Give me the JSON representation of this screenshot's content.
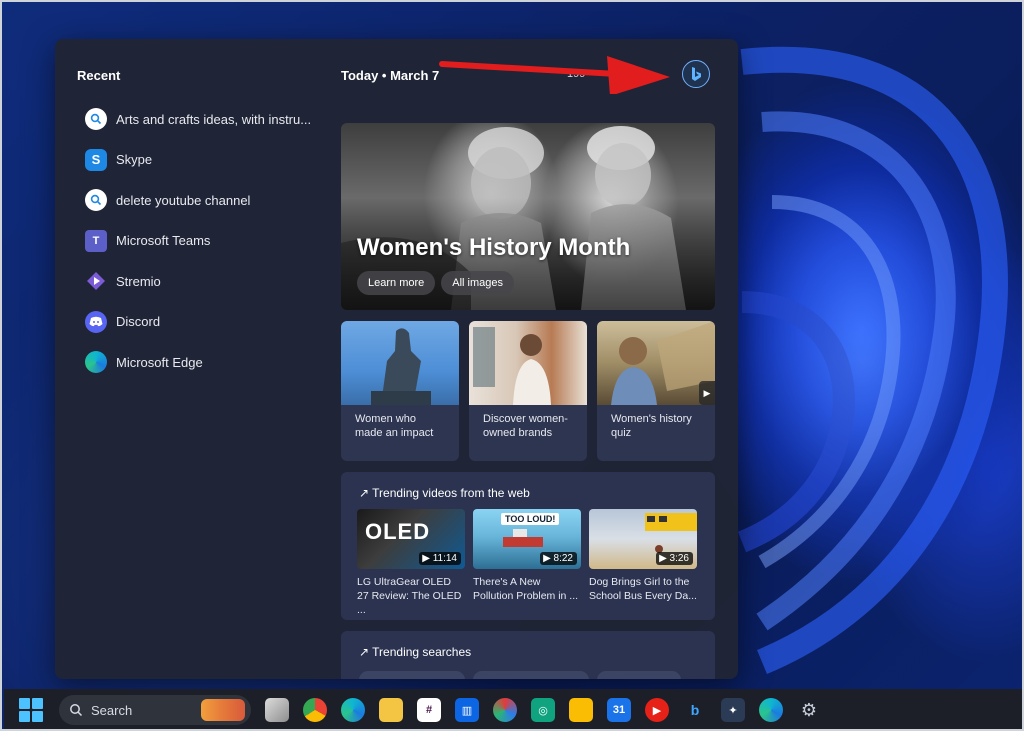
{
  "panel": {
    "recent_title": "Recent",
    "recent_items": [
      {
        "label": "Arts and crafts ideas, with instru...",
        "icon": "search-icon"
      },
      {
        "label": "Skype",
        "icon": "skype-icon"
      },
      {
        "label": "delete youtube channel",
        "icon": "search-icon"
      },
      {
        "label": "Microsoft Teams",
        "icon": "teams-icon"
      },
      {
        "label": "Stremio",
        "icon": "stremio-icon"
      },
      {
        "label": "Discord",
        "icon": "discord-icon"
      },
      {
        "label": "Microsoft Edge",
        "icon": "edge-icon"
      }
    ],
    "today_label": "Today  •  March 7",
    "points": "199",
    "hero": {
      "title": "Women's History Month",
      "learn_more": "Learn more",
      "all_images": "All images"
    },
    "cards": [
      {
        "caption": "Women who made an impact"
      },
      {
        "caption": "Discover women-owned brands"
      },
      {
        "caption": "Women's history quiz"
      }
    ],
    "trending_videos": {
      "title": "↗ Trending videos from the web",
      "items": [
        {
          "thumb_text": "OLED",
          "duration": "11:14",
          "caption": "LG UltraGear OLED 27 Review: The OLED ..."
        },
        {
          "thumb_text": "TOO LOUD!",
          "duration": "8:22",
          "caption": "There's A New Pollution Problem in ..."
        },
        {
          "thumb_text": "",
          "duration": "3:26",
          "caption": "Dog Brings Girl to the School Bus Every Da..."
        }
      ]
    },
    "trending_searches": {
      "title": "↗ Trending searches"
    }
  },
  "taskbar": {
    "search_label": "Search",
    "apps": [
      "file-explorer-icon",
      "chrome-icon",
      "edge-icon",
      "folder-icon",
      "slack-icon",
      "trello-icon",
      "davinci-icon",
      "chatgpt-icon",
      "keep-icon",
      "calendar-icon",
      "youtube-music-icon",
      "bing-icon",
      "resolve-icon",
      "edge-dev-icon",
      "settings-icon"
    ]
  },
  "colors": {
    "accent": "#4cc2ff",
    "panel_bg": "#202434",
    "annotation": "#e11d1d"
  }
}
